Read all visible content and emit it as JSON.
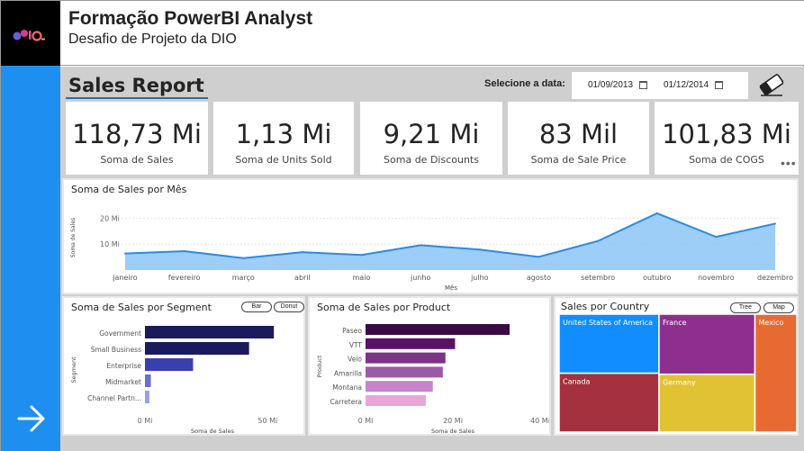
{
  "header": {
    "title": "Formação PowerBI Analyst",
    "subtitle": "Desafio de Projeto da DIO"
  },
  "report": {
    "title": "Sales Report",
    "date_label": "Selecione a data:",
    "date_start": "01/09/2013",
    "date_end": "01/12/2014"
  },
  "colors": {
    "rail": "#1e8fef",
    "line": "#2b8ae6",
    "area": "#8cc6f7"
  },
  "kpis": [
    {
      "value": "118,73 Mi",
      "label": "Soma de  Sales"
    },
    {
      "value": "1,13 Mi",
      "label": "Soma de Units Sold"
    },
    {
      "value": "9,21 Mi",
      "label": "Soma de Discounts"
    },
    {
      "value": "83 Mil",
      "label": "Soma de Sale Price"
    },
    {
      "value": "101,83 Mi",
      "label": "Soma de COGS"
    }
  ],
  "panels": {
    "segment_toggles": [
      "Bar",
      "Donut"
    ],
    "country_toggles": [
      "Tree",
      "Map"
    ]
  },
  "chart_data": [
    {
      "type": "area",
      "title": "Soma de Sales por Mês",
      "xlabel": "Mês",
      "ylabel": "Soma de Sales",
      "categories": [
        "janeiro",
        "fevereiro",
        "março",
        "abril",
        "maio",
        "junho",
        "julho",
        "agosto",
        "setembro",
        "outubro",
        "novembro",
        "dezembro"
      ],
      "values": [
        6.4,
        7.3,
        4.6,
        6.9,
        5.8,
        9.6,
        7.9,
        5.1,
        11.2,
        21.9,
        12.8,
        17.9
      ],
      "y_ticks": [
        {
          "v": 10,
          "label": "10 Mi"
        },
        {
          "v": 20,
          "label": "20 Mi"
        }
      ],
      "ylim": [
        0,
        25
      ],
      "grid": true
    },
    {
      "type": "bar",
      "title": "Soma de Sales por Segment",
      "xlabel": "Soma de Sales",
      "ylabel": "Segment",
      "categories": [
        "Government",
        "Small Business",
        "Enterprise",
        "Midmarket",
        "Channel Partn..."
      ],
      "values": [
        52.5,
        42.4,
        19.6,
        2.4,
        1.8
      ],
      "colors": [
        "#1b1a5e",
        "#1b1a5e",
        "#3b3fae",
        "#6a6fd0",
        "#9aa0e2"
      ],
      "x_ticks": [
        {
          "v": 0,
          "label": "0 Mi"
        },
        {
          "v": 50,
          "label": "50 Mi"
        }
      ],
      "xlim": [
        0,
        55
      ]
    },
    {
      "type": "bar",
      "title": "Soma de Sales por Product",
      "xlabel": "Soma de Sales",
      "ylabel": "Product",
      "categories": [
        "Paseo",
        "VTT",
        "Velo",
        "Amarilla",
        "Montana",
        "Carretera"
      ],
      "values": [
        33.0,
        20.5,
        18.3,
        17.7,
        15.4,
        13.8
      ],
      "colors": [
        "#3b0b43",
        "#5a1266",
        "#7b3486",
        "#9b5aa6",
        "#c585c8",
        "#e8a7d8"
      ],
      "x_ticks": [
        {
          "v": 0,
          "label": "0 Mi"
        },
        {
          "v": 20,
          "label": "20 Mi"
        },
        {
          "v": 40,
          "label": "40 Mi"
        }
      ],
      "xlim": [
        0,
        40
      ]
    },
    {
      "type": "treemap",
      "title": "Sales por Country",
      "items": [
        {
          "name": "United States of America",
          "value": 25.0,
          "color": "#118dff"
        },
        {
          "name": "Canada",
          "value": 24.9,
          "color": "#a4313d"
        },
        {
          "name": "France",
          "value": 24.4,
          "color": "#8e2f8e"
        },
        {
          "name": "Germany",
          "value": 23.5,
          "color": "#e1c233"
        },
        {
          "name": "Mexico",
          "value": 20.9,
          "color": "#e86a33"
        }
      ]
    }
  ]
}
